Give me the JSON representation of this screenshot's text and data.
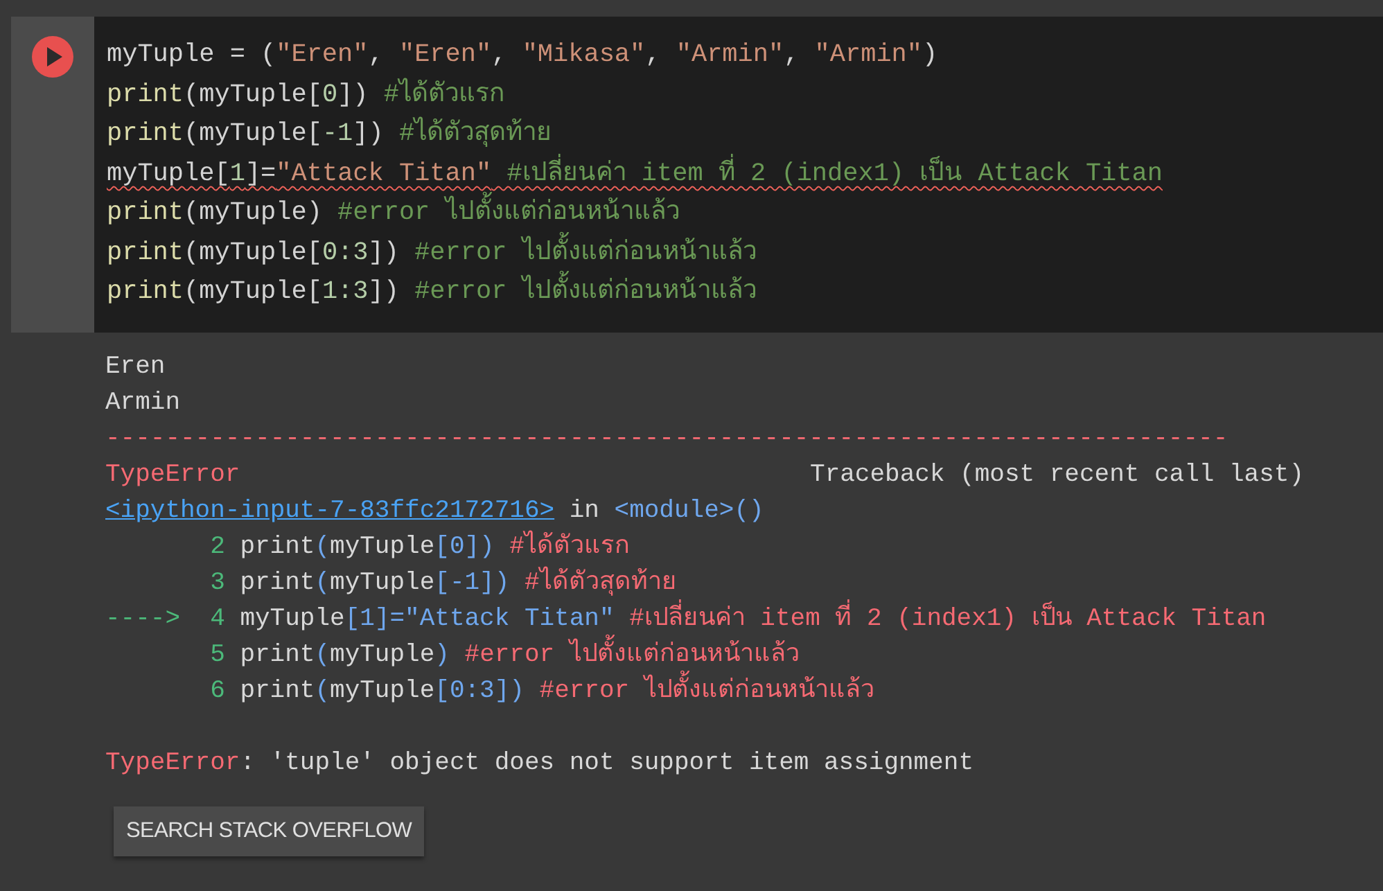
{
  "cell": {
    "code_lines": [
      {
        "error_underline": false,
        "tokens": [
          {
            "kind": "name",
            "text": "myTuple = ("
          },
          {
            "kind": "string",
            "text": "\"Eren\""
          },
          {
            "kind": "name",
            "text": ", "
          },
          {
            "kind": "string",
            "text": "\"Eren\""
          },
          {
            "kind": "name",
            "text": ", "
          },
          {
            "kind": "string",
            "text": "\"Mikasa\""
          },
          {
            "kind": "name",
            "text": ", "
          },
          {
            "kind": "string",
            "text": "\"Armin\""
          },
          {
            "kind": "name",
            "text": ", "
          },
          {
            "kind": "string",
            "text": "\"Armin\""
          },
          {
            "kind": "name",
            "text": ")"
          }
        ]
      },
      {
        "error_underline": false,
        "tokens": [
          {
            "kind": "func",
            "text": "print"
          },
          {
            "kind": "name",
            "text": "(myTuple["
          },
          {
            "kind": "number",
            "text": "0"
          },
          {
            "kind": "name",
            "text": "]) "
          },
          {
            "kind": "comment",
            "text": "#ได้ตัวแรก"
          }
        ]
      },
      {
        "error_underline": false,
        "tokens": [
          {
            "kind": "func",
            "text": "print"
          },
          {
            "kind": "name",
            "text": "(myTuple["
          },
          {
            "kind": "number",
            "text": "-1"
          },
          {
            "kind": "name",
            "text": "]) "
          },
          {
            "kind": "comment",
            "text": "#ได้ตัวสุดท้าย"
          }
        ]
      },
      {
        "error_underline": true,
        "tokens": [
          {
            "kind": "name",
            "text": "myTuple["
          },
          {
            "kind": "number",
            "text": "1"
          },
          {
            "kind": "name",
            "text": "]="
          },
          {
            "kind": "string",
            "text": "\"Attack Titan\""
          },
          {
            "kind": "comment",
            "text": " #เปลี่ยนค่า item ที่ 2 (index1) เป็น Attack Titan"
          }
        ]
      },
      {
        "error_underline": false,
        "tokens": [
          {
            "kind": "func",
            "text": "print"
          },
          {
            "kind": "name",
            "text": "(myTuple) "
          },
          {
            "kind": "comment",
            "text": "#error ไปตั้งแต่ก่อนหน้าแล้ว"
          }
        ]
      },
      {
        "error_underline": false,
        "tokens": [
          {
            "kind": "func",
            "text": "print"
          },
          {
            "kind": "name",
            "text": "(myTuple["
          },
          {
            "kind": "number",
            "text": "0:3"
          },
          {
            "kind": "name",
            "text": "]) "
          },
          {
            "kind": "comment",
            "text": "#error ไปตั้งแต่ก่อนหน้าแล้ว"
          }
        ]
      },
      {
        "error_underline": false,
        "tokens": [
          {
            "kind": "func",
            "text": "print"
          },
          {
            "kind": "name",
            "text": "(myTuple["
          },
          {
            "kind": "number",
            "text": "1:3"
          },
          {
            "kind": "name",
            "text": "]) "
          },
          {
            "kind": "comment",
            "text": "#error ไปตั้งแต่ก่อนหน้าแล้ว"
          }
        ]
      }
    ]
  },
  "output": {
    "lines": [
      {
        "kind": "text",
        "tokens": [
          {
            "kind": "plain",
            "text": "Eren"
          }
        ]
      },
      {
        "kind": "text",
        "tokens": [
          {
            "kind": "plain",
            "text": "Armin"
          }
        ]
      },
      {
        "kind": "text",
        "tokens": [
          {
            "kind": "error",
            "text": "---------------------------------------------------------------------------"
          }
        ]
      },
      {
        "kind": "header",
        "tokens": [
          {
            "kind": "error",
            "text": "TypeError"
          },
          {
            "kind": "plain",
            "text": "Traceback (most recent call last)"
          }
        ]
      },
      {
        "kind": "location",
        "link": "<ipython-input-7-83ffc2172716>",
        "tokens": [
          {
            "kind": "plain",
            "text": " in "
          },
          {
            "kind": "punct",
            "text": "<module>()"
          }
        ]
      },
      {
        "kind": "source",
        "number": "2",
        "tokens": [
          {
            "kind": "plain",
            "text": "print"
          },
          {
            "kind": "punct",
            "text": "("
          },
          {
            "kind": "plain",
            "text": "myTuple"
          },
          {
            "kind": "punct",
            "text": "[0])"
          },
          {
            "kind": "comment",
            "text": " #ได้ตัวแรก"
          }
        ]
      },
      {
        "kind": "source",
        "number": "3",
        "tokens": [
          {
            "kind": "plain",
            "text": "print"
          },
          {
            "kind": "punct",
            "text": "("
          },
          {
            "kind": "plain",
            "text": "myTuple"
          },
          {
            "kind": "punct",
            "text": "[-1])"
          },
          {
            "kind": "comment",
            "text": " #ได้ตัวสุดท้าย"
          }
        ]
      },
      {
        "kind": "source",
        "marker": "---->",
        "number": "4",
        "tokens": [
          {
            "kind": "plain",
            "text": "myTuple"
          },
          {
            "kind": "punct",
            "text": "[1]=\"Attack Titan\""
          },
          {
            "kind": "comment",
            "text": " #เปลี่ยนค่า item ที่ 2 (index1) เป็น Attack Titan"
          }
        ]
      },
      {
        "kind": "source",
        "number": "5",
        "tokens": [
          {
            "kind": "plain",
            "text": "print"
          },
          {
            "kind": "punct",
            "text": "("
          },
          {
            "kind": "plain",
            "text": "myTuple"
          },
          {
            "kind": "punct",
            "text": ")"
          },
          {
            "kind": "comment",
            "text": " #error ไปตั้งแต่ก่อนหน้าแล้ว"
          }
        ]
      },
      {
        "kind": "source",
        "number": "6",
        "tokens": [
          {
            "kind": "plain",
            "text": "print"
          },
          {
            "kind": "punct",
            "text": "("
          },
          {
            "kind": "plain",
            "text": "myTuple"
          },
          {
            "kind": "punct",
            "text": "[0:3])"
          },
          {
            "kind": "comment",
            "text": " #error ไปตั้งแต่ก่อนหน้าแล้ว"
          }
        ]
      },
      {
        "kind": "blank"
      },
      {
        "kind": "text",
        "tokens": [
          {
            "kind": "error",
            "text": "TypeError"
          },
          {
            "kind": "plain",
            "text": ": 'tuple' object does not support item assignment"
          }
        ]
      }
    ],
    "button": "SEARCH STACK OVERFLOW"
  }
}
